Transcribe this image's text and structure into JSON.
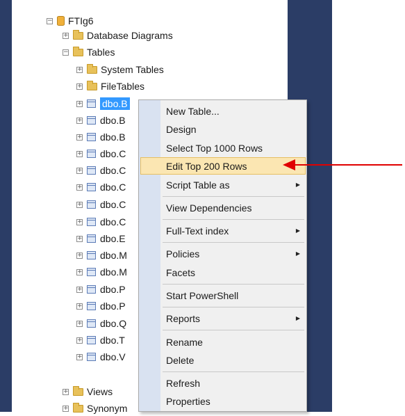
{
  "tree": {
    "database": "FTIg6",
    "folders": {
      "database_diagrams": "Database Diagrams",
      "tables": "Tables",
      "system_tables": "System Tables",
      "file_tables": "FileTables",
      "views": "Views",
      "synonyms": "Synonym"
    },
    "selected_table": "dbo.B",
    "tables": [
      "dbo.B",
      "dbo.B",
      "dbo.B",
      "dbo.C",
      "dbo.C",
      "dbo.C",
      "dbo.C",
      "dbo.C",
      "dbo.E",
      "dbo.M",
      "dbo.M",
      "dbo.P",
      "dbo.P",
      "dbo.Q",
      "dbo.T",
      "dbo.V"
    ]
  },
  "context_menu": {
    "items": [
      {
        "label": "New Table..."
      },
      {
        "label": "Design"
      },
      {
        "label": "Select Top 1000 Rows"
      },
      {
        "label": "Edit Top 200 Rows",
        "highlighted": true
      },
      {
        "label": "Script Table as",
        "submenu": true
      },
      {
        "label": "View Dependencies"
      },
      {
        "label": "Full-Text index",
        "submenu": true
      },
      {
        "label": "Policies",
        "submenu": true
      },
      {
        "label": "Facets"
      },
      {
        "label": "Start PowerShell"
      },
      {
        "label": "Reports",
        "submenu": true
      },
      {
        "label": "Rename"
      },
      {
        "label": "Delete"
      },
      {
        "label": "Refresh"
      },
      {
        "label": "Properties"
      }
    ]
  },
  "annotation": {
    "color": "#e00000",
    "icon": "red-arrow-pointing-left"
  }
}
